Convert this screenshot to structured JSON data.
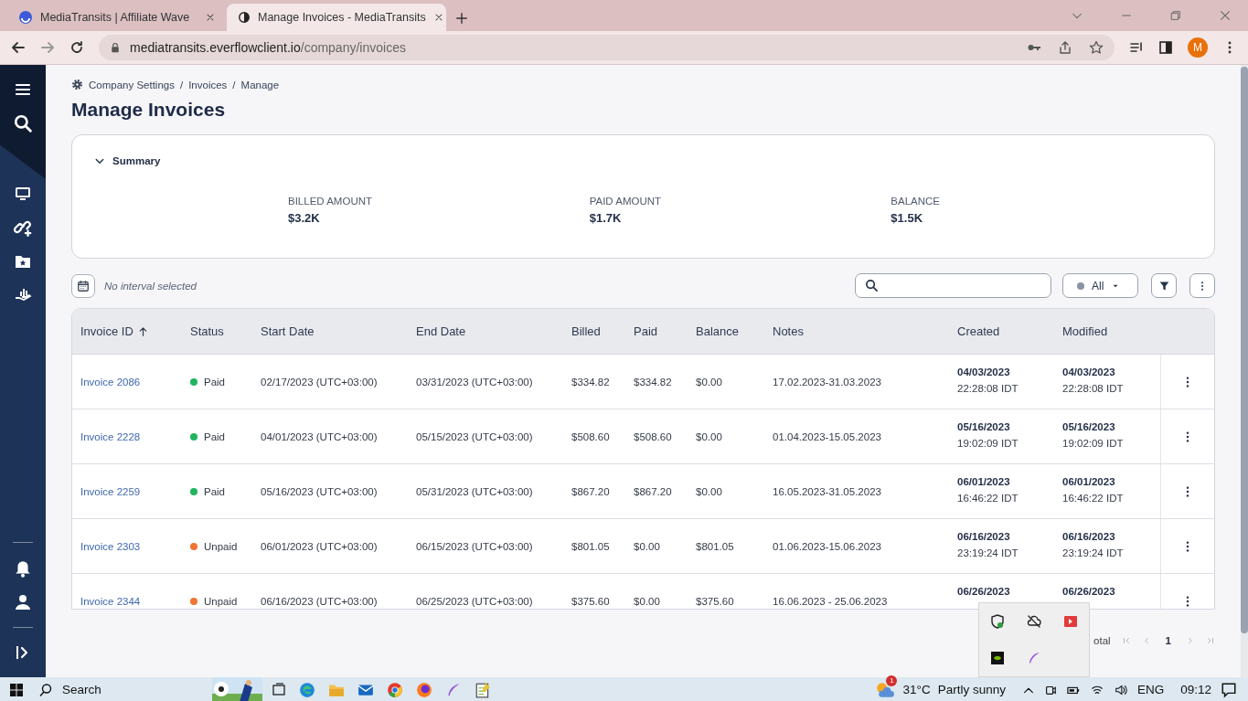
{
  "browser": {
    "tabs": [
      {
        "title": "MediaTransits | Affiliate Wave",
        "selected": false
      },
      {
        "title": "Manage Invoices - MediaTransits",
        "selected": true
      }
    ],
    "url_host": "mediatransits.everflowclient.io",
    "url_path": "/company/invoices",
    "profile_initial": "M"
  },
  "breadcrumb": [
    "Company Settings",
    "Invoices",
    "Manage"
  ],
  "breadcrumb_separator": "/",
  "page_title": "Manage Invoices",
  "summary": {
    "title": "Summary",
    "expanded": true,
    "metrics": [
      {
        "label": "BILLED AMOUNT",
        "value": "$3.2K"
      },
      {
        "label": "PAID AMOUNT",
        "value": "$1.7K"
      },
      {
        "label": "BALANCE",
        "value": "$1.5K"
      }
    ]
  },
  "toolbar": {
    "interval": "No interval selected",
    "status_filter": "All"
  },
  "table": {
    "columns": [
      {
        "label": "Invoice ID",
        "sorted": true
      },
      {
        "label": "Status",
        "sorted": false
      },
      {
        "label": "Start Date",
        "sorted": false
      },
      {
        "label": "End Date",
        "sorted": false
      },
      {
        "label": "Billed",
        "sorted": false
      },
      {
        "label": "Paid",
        "sorted": false
      },
      {
        "label": "Balance",
        "sorted": false
      },
      {
        "label": "Notes",
        "sorted": false
      },
      {
        "label": "Created",
        "sorted": false
      },
      {
        "label": "Modified",
        "sorted": false
      }
    ],
    "rows": [
      {
        "invoice": "Invoice 2086",
        "status": "Paid",
        "color": "#22b35e",
        "start": "02/17/2023 (UTC+03:00)",
        "end": "03/31/2023 (UTC+03:00)",
        "billed": "$334.82",
        "paid": "$334.82",
        "balance": "$0.00",
        "notes": "17.02.2023-31.03.2023",
        "created_date": "04/03/2023",
        "created_time": "22:28:08 IDT",
        "modified_date": "04/03/2023",
        "modified_time": "22:28:08 IDT"
      },
      {
        "invoice": "Invoice 2228",
        "status": "Paid",
        "color": "#22b35e",
        "start": "04/01/2023 (UTC+03:00)",
        "end": "05/15/2023 (UTC+03:00)",
        "billed": "$508.60",
        "paid": "$508.60",
        "balance": "$0.00",
        "notes": "01.04.2023-15.05.2023",
        "created_date": "05/16/2023",
        "created_time": "19:02:09 IDT",
        "modified_date": "05/16/2023",
        "modified_time": "19:02:09 IDT"
      },
      {
        "invoice": "Invoice 2259",
        "status": "Paid",
        "color": "#22b35e",
        "start": "05/16/2023 (UTC+03:00)",
        "end": "05/31/2023 (UTC+03:00)",
        "billed": "$867.20",
        "paid": "$867.20",
        "balance": "$0.00",
        "notes": "16.05.2023-31.05.2023",
        "created_date": "06/01/2023",
        "created_time": "16:46:22 IDT",
        "modified_date": "06/01/2023",
        "modified_time": "16:46:22 IDT"
      },
      {
        "invoice": "Invoice 2303",
        "status": "Unpaid",
        "color": "#ee7632",
        "start": "06/01/2023 (UTC+03:00)",
        "end": "06/15/2023 (UTC+03:00)",
        "billed": "$801.05",
        "paid": "$0.00",
        "balance": "$801.05",
        "notes": "01.06.2023-15.06.2023",
        "created_date": "06/16/2023",
        "created_time": "23:19:24 IDT",
        "modified_date": "06/16/2023",
        "modified_time": "23:19:24 IDT"
      },
      {
        "invoice": "Invoice 2344",
        "status": "Unpaid",
        "color": "#ee7632",
        "start": "06/16/2023 (UTC+03:00)",
        "end": "06/25/2023 (UTC+03:00)",
        "billed": "$375.60",
        "paid": "$0.00",
        "balance": "$375.60",
        "notes": "16.06.2023 - 25.06.2023",
        "created_date": "06/26/2023",
        "modified_date": "06/26/2023"
      }
    ]
  },
  "pagination": {
    "total_label": "otal",
    "page": "1"
  },
  "taskbar": {
    "search": "Search",
    "weather_badge": "1",
    "temperature": "31°C",
    "weather": "Partly sunny",
    "language": "ENG",
    "time": "09:12"
  }
}
